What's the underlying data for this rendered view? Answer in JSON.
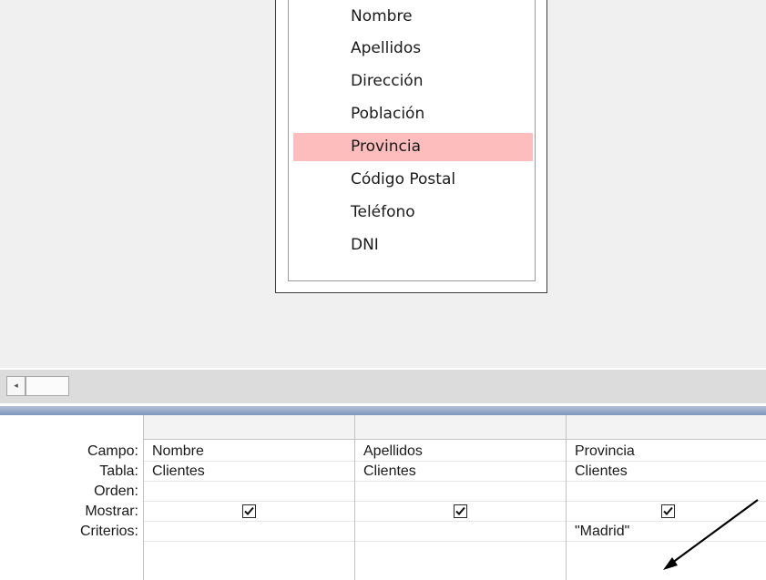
{
  "table": {
    "fields": [
      "Nombre",
      "Apellidos",
      "Dirección",
      "Población",
      "Provincia",
      "Código Postal",
      "Teléfono",
      "DNI"
    ],
    "selected_field": "Provincia"
  },
  "scrollbar": {
    "left_arrow": "◂"
  },
  "grid": {
    "row_labels": [
      "Campo:",
      "Tabla:",
      "Orden:",
      "Mostrar:",
      "Criterios:"
    ],
    "columns": [
      {
        "campo": "Nombre",
        "tabla": "Clientes",
        "orden": "",
        "mostrar": true,
        "criterios": ""
      },
      {
        "campo": "Apellidos",
        "tabla": "Clientes",
        "orden": "",
        "mostrar": true,
        "criterios": ""
      },
      {
        "campo": "Provincia",
        "tabla": "Clientes",
        "orden": "",
        "mostrar": true,
        "criterios": "\"Madrid\""
      }
    ]
  },
  "colors": {
    "selected_field_bg": "#fdbdbd",
    "splitter": "#8ea3c6"
  }
}
